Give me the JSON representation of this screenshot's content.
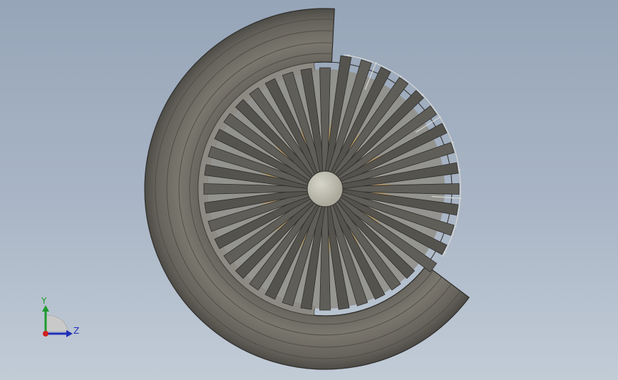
{
  "viewport": {
    "model_name": "turbofan-fan-section-cutaway",
    "colors": {
      "background_top": "#96a5b8",
      "background_bottom": "#c2ccd7",
      "casing": "#6e6b63",
      "casing_dark": "#4e4b45",
      "blade": "#55534e",
      "blade_edge": "#2e2d2a",
      "hub": "#c6c5b8",
      "accent_gold": "#b59a68"
    },
    "blade_count": 40
  },
  "triad": {
    "y_label": "Y",
    "z_label": "Z",
    "colors": {
      "y": "#1e9a2e",
      "z": "#1f2fb8",
      "x": "#d02020",
      "plane": "#c9c9c9"
    }
  }
}
